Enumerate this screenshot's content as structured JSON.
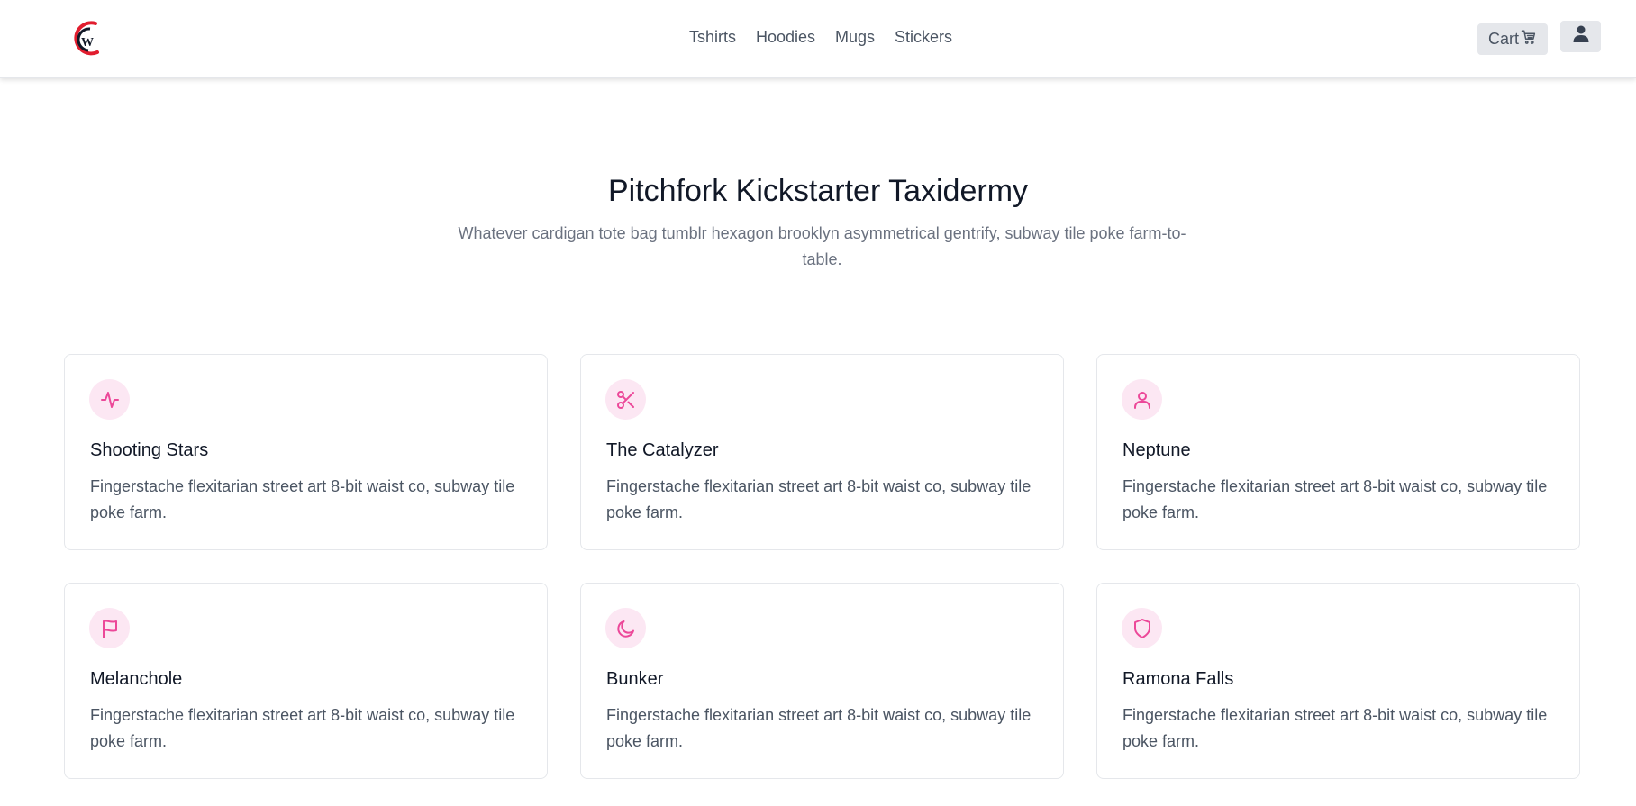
{
  "header": {
    "logo_alt": "CW logo",
    "nav": [
      "Tshirts",
      "Hoodies",
      "Mugs",
      "Stickers"
    ],
    "cart_label": "Cart",
    "cart_icon": "cart-icon",
    "user_icon": "user-icon"
  },
  "hero": {
    "title": "Pitchfork Kickstarter Taxidermy",
    "subtitle": "Whatever cardigan tote bag tumblr hexagon brooklyn asymmetrical gentrify, subway tile poke farm-to-table."
  },
  "cards": [
    {
      "title": "Shooting Stars",
      "text": "Fingerstache flexitarian street art 8-bit waist co, subway tile poke farm.",
      "icon": "activity-icon"
    },
    {
      "title": "The Catalyzer",
      "text": "Fingerstache flexitarian street art 8-bit waist co, subway tile poke farm.",
      "icon": "scissors-icon"
    },
    {
      "title": "Neptune",
      "text": "Fingerstache flexitarian street art 8-bit waist co, subway tile poke farm.",
      "icon": "user-icon"
    },
    {
      "title": "Melanchole",
      "text": "Fingerstache flexitarian street art 8-bit waist co, subway tile poke farm.",
      "icon": "flag-icon"
    },
    {
      "title": "Bunker",
      "text": "Fingerstache flexitarian street art 8-bit waist co, subway tile poke farm.",
      "icon": "moon-icon"
    },
    {
      "title": "Ramona Falls",
      "text": "Fingerstache flexitarian street art 8-bit waist co, subway tile poke farm.",
      "icon": "shield-icon"
    }
  ],
  "colors": {
    "accent": "#ec4899",
    "accent_bg": "#fce7f3",
    "button_bg": "#e5e7eb",
    "logo_red": "#e11d2e"
  }
}
